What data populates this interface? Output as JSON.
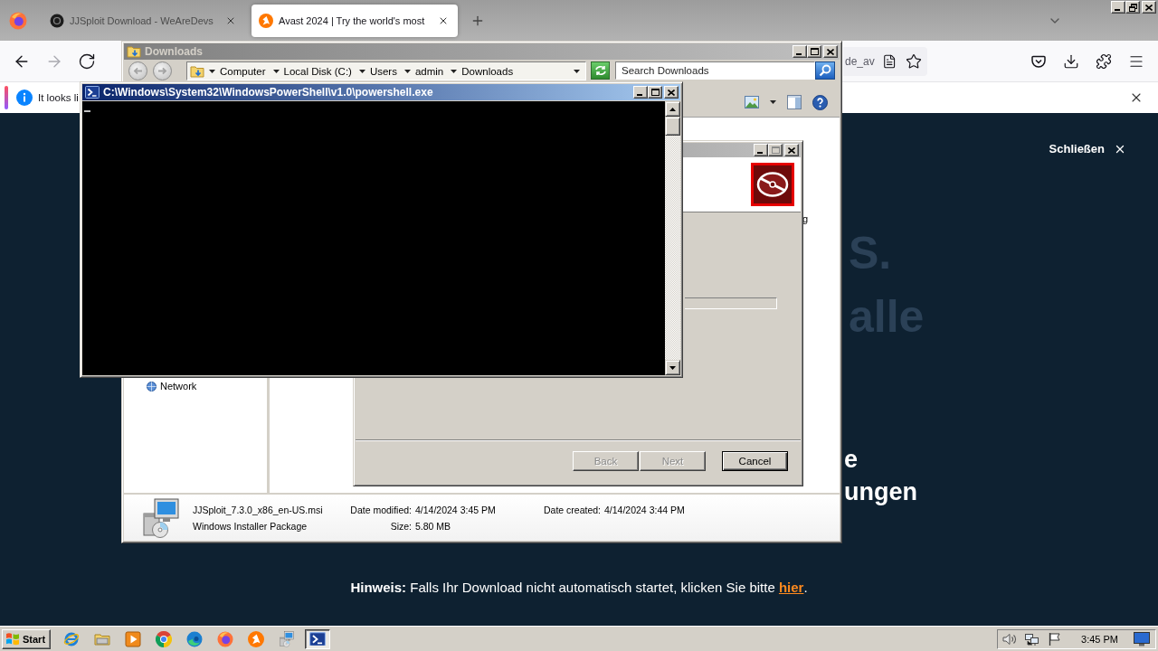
{
  "browser": {
    "tabs": [
      {
        "title": "JJSploit Download - WeAreDevs",
        "selected": false
      },
      {
        "title": "Avast 2024 | Try the world's most",
        "selected": true
      }
    ],
    "forward_button": {
      "disabled": true
    },
    "address_bar": {
      "value": "de_av"
    },
    "notification": {
      "text": "It looks li"
    },
    "page": {
      "close_label": "Schließen",
      "headline": [
        "S.",
        "alle"
      ],
      "subheadline": [
        "e",
        "ungen"
      ],
      "notice": {
        "text": "**Hinweis:** Falls Ihr Download nicht automatisch startet, klicken Sie bitte",
        "link": "hier",
        "end": "."
      }
    }
  },
  "explorer": {
    "title": "Downloads",
    "back_button": {
      "disabled": true
    },
    "forward_button": {
      "disabled": true
    },
    "breadcrumb": [
      "Computer",
      "Local Disk (C:)",
      "Users",
      "admin",
      "Downloads"
    ],
    "search": {
      "placeholder": "Search Downloads"
    },
    "navigation": [
      {
        "label": "Network"
      }
    ],
    "file_list_fragment": "g",
    "details": {
      "name": "JJSploit_7.3.0_x86_en-US.msi",
      "type": "Windows Installer Package",
      "date_modified": {
        "label": "Date modified:",
        "value": "4/14/2024 3:45 PM"
      },
      "size": {
        "label": "Size:",
        "value": "5.80 MB"
      },
      "date_created": {
        "label": "Date created:",
        "value": "4/14/2024 3:44 PM"
      }
    }
  },
  "installer": {
    "maximize_button": {
      "disabled": true
    },
    "buttons": [
      {
        "label": "Back",
        "disabled": true,
        "default": false
      },
      {
        "label": "Next",
        "disabled": true,
        "default": false
      },
      {
        "label": "Cancel",
        "disabled": false,
        "default": true
      }
    ]
  },
  "powershell": {
    "title": "C:\\Windows\\System32\\WindowsPowerShell\\v1.0\\powershell.exe"
  },
  "taskbar": {
    "start": "Start",
    "apps": [
      {
        "kind": "ie",
        "active": false
      },
      {
        "kind": "explorer",
        "active": false
      },
      {
        "kind": "media",
        "active": false
      },
      {
        "kind": "chrome",
        "active": false
      },
      {
        "kind": "edge",
        "active": false
      },
      {
        "kind": "firefox",
        "active": false
      },
      {
        "kind": "avast",
        "active": false
      },
      {
        "kind": "installer",
        "active": false
      },
      {
        "kind": "powershell",
        "active": true
      }
    ],
    "clock": "3:45 PM"
  }
}
